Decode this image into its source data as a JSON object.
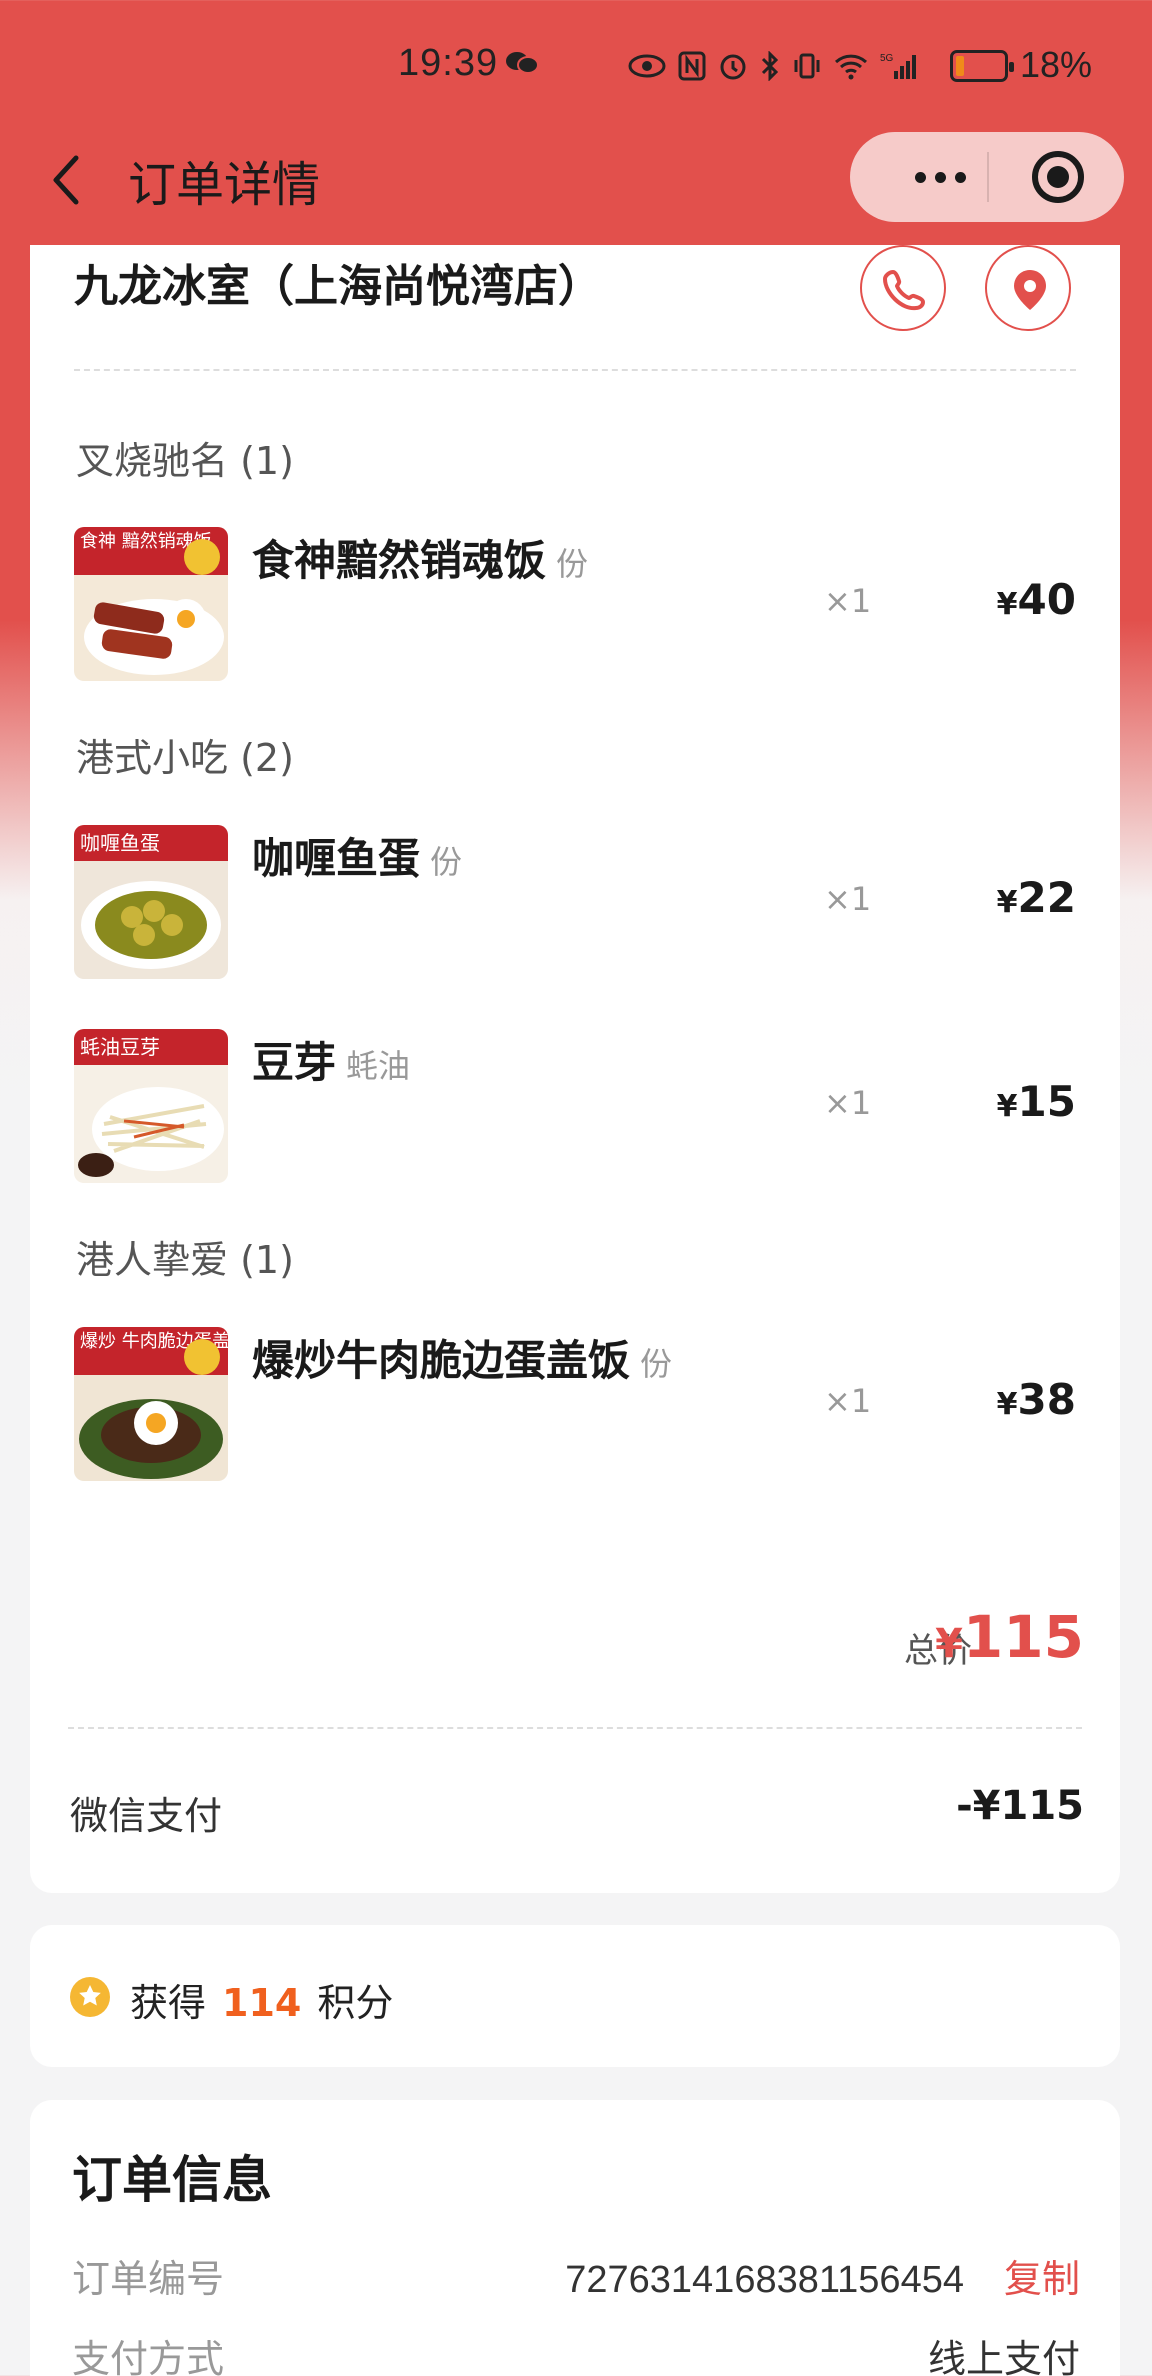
{
  "status_bar": {
    "time": "19:39",
    "battery": "18%",
    "battery_level": 0.18
  },
  "nav": {
    "title": "订单详情"
  },
  "store": {
    "name": "九龙冰室（上海尚悦湾店）"
  },
  "categories": [
    {
      "label": "叉烧驰名 (1)",
      "items": [
        {
          "name": "食神黯然销魂饭",
          "spec": "份",
          "qty": "×1",
          "price": "40",
          "thumb_caption": "食神 黯然销魂饭"
        }
      ]
    },
    {
      "label": "港式小吃 (2)",
      "items": [
        {
          "name": "咖喱鱼蛋",
          "spec": "份",
          "qty": "×1",
          "price": "22",
          "thumb_caption": "咖喱鱼蛋"
        },
        {
          "name": "豆芽",
          "spec": "蚝油",
          "qty": "×1",
          "price": "15",
          "thumb_caption": "蚝油豆芽"
        }
      ]
    },
    {
      "label": "港人挚爱 (1)",
      "items": [
        {
          "name": "爆炒牛肉脆边蛋盖饭",
          "spec": "份",
          "qty": "×1",
          "price": "38",
          "thumb_caption": "爆炒 牛肉脆边蛋盖饭"
        }
      ]
    }
  ],
  "currency": "¥",
  "total": {
    "label": "总价",
    "value": "115"
  },
  "payment": {
    "label": "微信支付",
    "value": "-¥115"
  },
  "points": {
    "prefix": "获得",
    "value": "114",
    "suffix": "积分"
  },
  "order_info": {
    "title": "订单信息",
    "number_label": "订单编号",
    "number_value": "7276314168381156454",
    "copy_label": "复制",
    "pay_method_label": "支付方式",
    "pay_method_value": "线上支付"
  },
  "colors": {
    "brand_red": "#e2504c",
    "points_orange": "#f0601e",
    "star_yellow": "#f5b733"
  },
  "icons": [
    "message-icon",
    "eye-icon",
    "nfc-icon",
    "alarm-icon",
    "bluetooth-icon",
    "vibrate-icon",
    "wifi-icon",
    "signal-icon",
    "battery-icon",
    "back-icon",
    "more-icon",
    "capsule-close-icon",
    "phone-icon",
    "location-icon",
    "points-star-icon"
  ]
}
